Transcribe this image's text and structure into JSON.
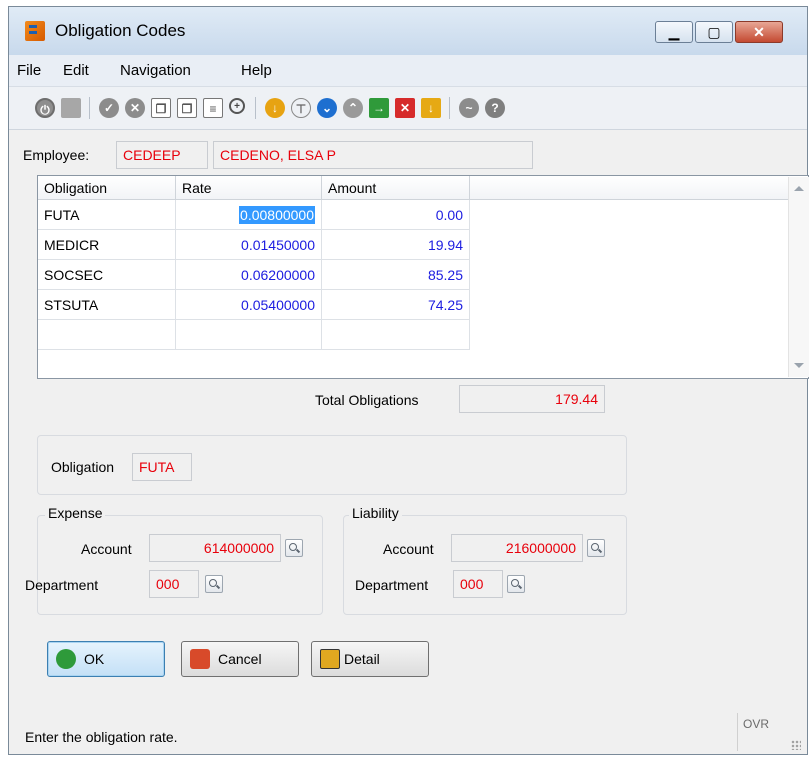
{
  "window": {
    "title": "Obligation Codes"
  },
  "menu": [
    "File",
    "Edit",
    "Navigation",
    "Help"
  ],
  "toolbar_icons": [
    "power-icon",
    "window-icon",
    "check-icon",
    "cancel-icon",
    "copy-icon",
    "paste-icon",
    "document-icon",
    "zoom-icon",
    "download-icon",
    "filter-icon",
    "scroll-down-icon",
    "scroll-up-icon",
    "import-icon",
    "delete-icon",
    "export-icon",
    "chart-icon",
    "help-icon"
  ],
  "employee": {
    "label": "Employee:",
    "code": "CEDEEP",
    "name": "CEDENO, ELSA P"
  },
  "grid": {
    "columns": [
      "Obligation",
      "Rate",
      "Amount"
    ],
    "rows": [
      {
        "obligation": "FUTA",
        "rate": "0.00800000",
        "amount": "0.00"
      },
      {
        "obligation": "MEDICR",
        "rate": "0.01450000",
        "amount": "19.94"
      },
      {
        "obligation": "SOCSEC",
        "rate": "0.06200000",
        "amount": "85.25"
      },
      {
        "obligation": "STSUTA",
        "rate": "0.05400000",
        "amount": "74.25"
      }
    ]
  },
  "total": {
    "label": "Total Obligations",
    "value": "179.44"
  },
  "obligation": {
    "label": "Obligation",
    "value": "FUTA"
  },
  "expense": {
    "title": "Expense",
    "account_label": "Account",
    "account": "614000000",
    "department_label": "Department",
    "department": "000"
  },
  "liability": {
    "title": "Liability",
    "account_label": "Account",
    "account": "216000000",
    "department_label": "Department",
    "department": "000"
  },
  "buttons": {
    "ok": "OK",
    "cancel": "Cancel",
    "detail": "Detail"
  },
  "status": {
    "message": "Enter the obligation rate.",
    "mode": "OVR"
  },
  "colors": {
    "value_red": "#e8000b",
    "value_blue": "#1c1ce0",
    "selection": "#3399ff"
  }
}
